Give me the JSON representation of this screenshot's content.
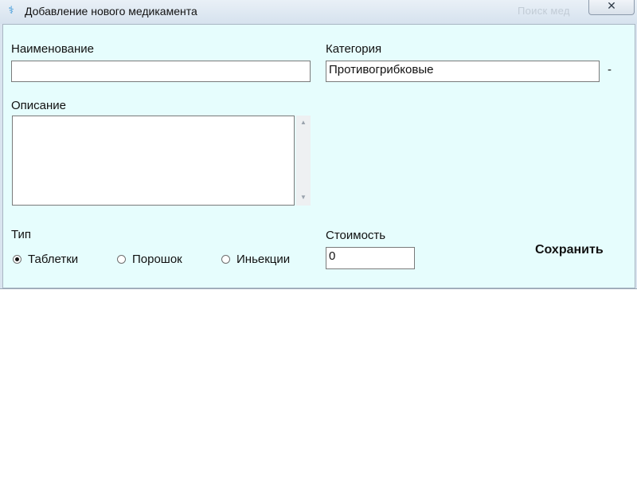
{
  "window": {
    "title": "Добавление нового медикамента",
    "background_window_text": "Поиск мед",
    "close_label": "✕",
    "icon": "caduceus-icon"
  },
  "form": {
    "name_label": "Наименование",
    "name_value": "",
    "category_label": "Категория",
    "category_value": "Противогрибковые",
    "category_dash": "-",
    "description_label": "Описание",
    "description_value": "",
    "type_label": "Тип",
    "type_options": [
      {
        "label": "Таблетки",
        "checked": true
      },
      {
        "label": "Порошок",
        "checked": false
      },
      {
        "label": "Иньекции",
        "checked": false
      }
    ],
    "cost_label": "Стоимость",
    "cost_value": "0",
    "save_label": "Сохранить"
  },
  "colors": {
    "client_background": "#e6fdfd",
    "title_bar": "#d6e2ee"
  }
}
